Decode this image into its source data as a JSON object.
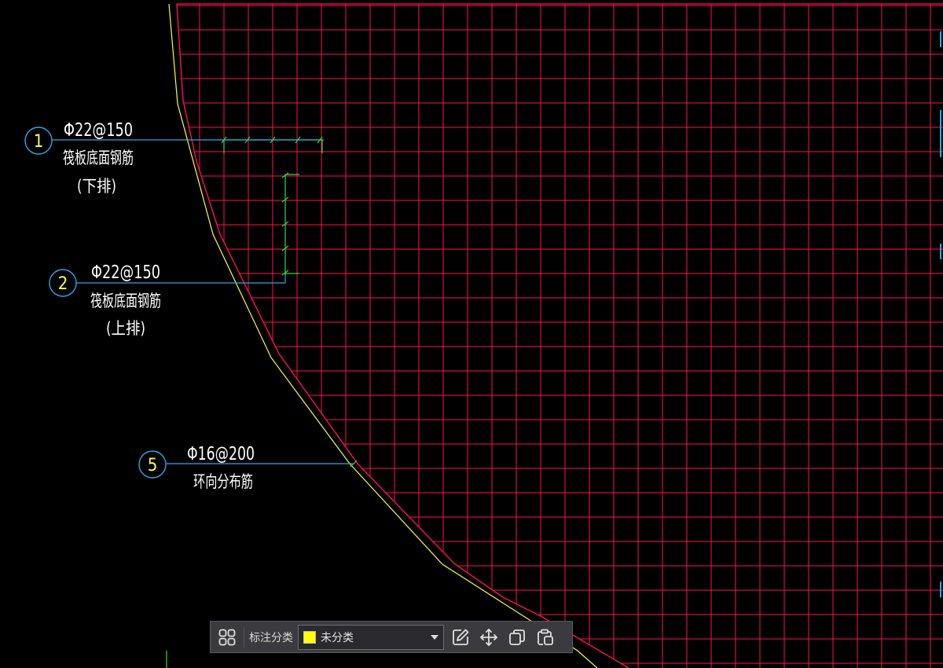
{
  "drawing": {
    "background": "#000000",
    "grid_color": "#ff1050",
    "boundary_color": "#ff1050",
    "outline_color": "#ffff33",
    "leader_color": "#2ca8e8",
    "rebar_marker_color": "#33dd33",
    "text_color": "#ffffff",
    "bubble_text_color": "#ffff44",
    "callouts": [
      {
        "number": "1",
        "spec": "Φ22@150",
        "desc": "筏板底面钢筋",
        "note": "(下排)"
      },
      {
        "number": "2",
        "spec": "Φ22@150",
        "desc": "筏板底面钢筋",
        "note": "(上排)"
      },
      {
        "number": "5",
        "spec": "Φ16@200",
        "desc": "环向分布筋",
        "note": ""
      }
    ]
  },
  "toolbar": {
    "grid_icon": "four-squares-icon",
    "label": "标注分类",
    "category": {
      "value": "未分类",
      "swatch_color": "#ffff00"
    },
    "buttons": [
      {
        "name": "edit",
        "icon": "edit-icon"
      },
      {
        "name": "move",
        "icon": "move-icon"
      },
      {
        "name": "copy",
        "icon": "copy-icon"
      },
      {
        "name": "paste",
        "icon": "paste-icon"
      }
    ]
  }
}
